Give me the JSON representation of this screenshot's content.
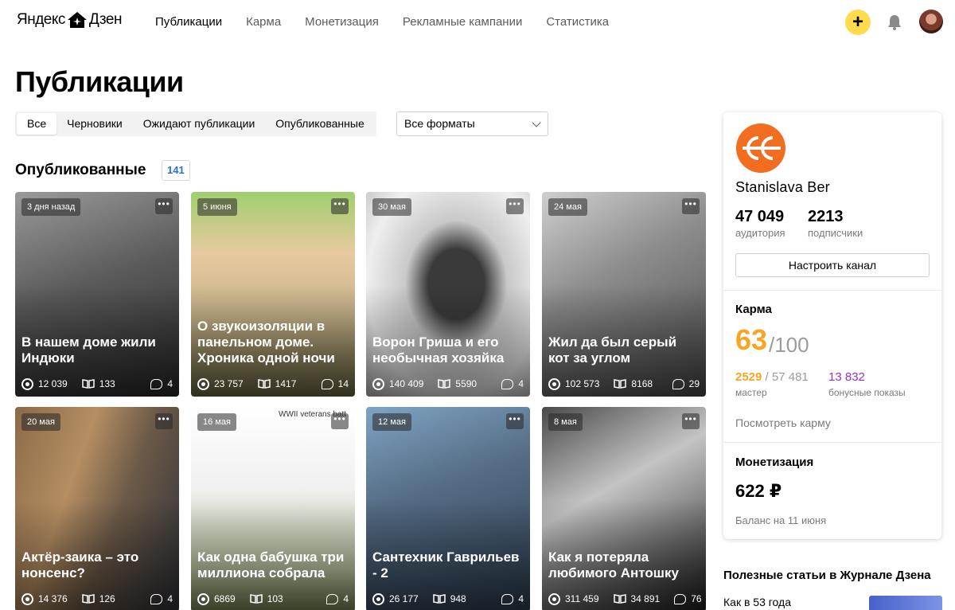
{
  "header": {
    "logo": {
      "left": "Яндекс",
      "right": "Дзен"
    },
    "nav": [
      {
        "label": "Публикации",
        "active": true
      },
      {
        "label": "Карма",
        "active": false
      },
      {
        "label": "Монетизация",
        "active": false
      },
      {
        "label": "Рекламные кампании",
        "active": false
      },
      {
        "label": "Статистика",
        "active": false
      }
    ],
    "add_label": "+",
    "accent": "#ffdb4d"
  },
  "page": {
    "title": "Публикации",
    "tabs": [
      "Все",
      "Черновики",
      "Ожидают публикации",
      "Опубликованные"
    ],
    "format_select": "Все форматы",
    "section_title": "Опубликованные",
    "section_count": "141"
  },
  "cards": [
    {
      "date": "3 дня назад",
      "title": "В нашем доме жили Индюки",
      "views": "12 039",
      "reads": "133",
      "comments": "4",
      "bg": "bw-portrait"
    },
    {
      "date": "5 июня",
      "title": "О звукоизоляции в панельном доме. Хроника одной ночи",
      "views": "23 757",
      "reads": "1417",
      "comments": "14",
      "bg": "frogs"
    },
    {
      "date": "30 мая",
      "title": "Ворон Гриша и его необычная хозяйка",
      "views": "140 409",
      "reads": "5590",
      "comments": "4",
      "bg": "crow"
    },
    {
      "date": "24 мая",
      "title": "Жил да был серый кот за углом",
      "views": "102 573",
      "reads": "8168",
      "comments": "29",
      "bg": "cat"
    },
    {
      "date": "20 мая",
      "title": "Актёр-заика – это нонсенс?",
      "views": "14 376",
      "reads": "126",
      "comments": "4",
      "bg": "eye"
    },
    {
      "date": "16 мая",
      "title": "Как одна бабушка три миллиона собрала",
      "views": "6869",
      "reads": "103",
      "comments": "4",
      "bg": "cartoon",
      "caption": "WWII veterans batt"
    },
    {
      "date": "12 мая",
      "title": "Сантехник Гаврильев - 2",
      "views": "26 177",
      "reads": "948",
      "comments": "4",
      "bg": "plumber"
    },
    {
      "date": "8 мая",
      "title": "Как я потеряла любимого Антошку",
      "views": "311 459",
      "reads": "34 891",
      "comments": "76",
      "bg": "woman"
    }
  ],
  "panel": {
    "channel_name": "Stanislava Ber",
    "logo_color": "#f36d21",
    "audience": {
      "value": "47 049",
      "label": "аудитория"
    },
    "subscribers": {
      "value": "2213",
      "label": "подписчики"
    },
    "config_button": "Настроить канал",
    "karma": {
      "heading": "Карма",
      "value": "63",
      "of": "/100",
      "master_value": "2529",
      "master_total": " / 57 481",
      "master_label": "мастер",
      "bonus_value": "13 832",
      "bonus_label": "бонусные показы",
      "link": "Посмотреть карму",
      "karma_color": "#f6a623",
      "bonus_color": "#9b2ec4"
    },
    "monetization": {
      "heading": "Монетизация",
      "amount": "622 ₽",
      "balance_label": "Баланс на 11 июня"
    }
  },
  "journal": {
    "title": "Полезные статьи в Журнале Дзена",
    "first_item": "Как в 53 года"
  }
}
